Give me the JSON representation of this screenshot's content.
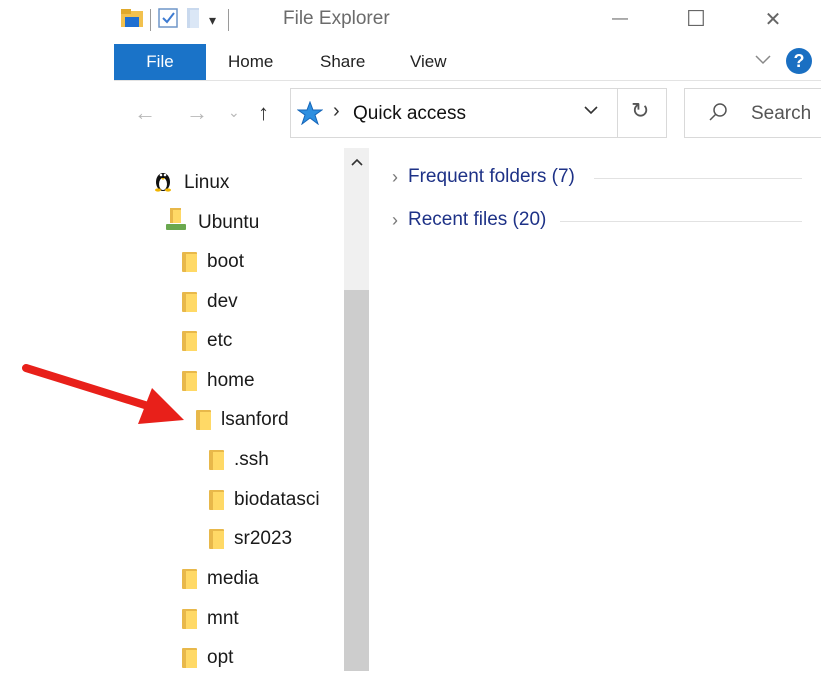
{
  "window": {
    "title": "File Explorer",
    "minimize_glyph": "—",
    "maximize_glyph": "☐",
    "close_glyph": "✕"
  },
  "ribbon": {
    "tabs": [
      "File",
      "Home",
      "Share",
      "View"
    ],
    "active_tab": "File",
    "help_label": "?"
  },
  "address_bar": {
    "location": "Quick access",
    "location_icon": "quick-access-star-icon"
  },
  "search": {
    "placeholder": "Search"
  },
  "navigation_pane": {
    "items": [
      {
        "label": "Linux",
        "icon": "linux-penguin-icon",
        "level": 0
      },
      {
        "label": "Ubuntu",
        "icon": "drive-icon",
        "level": 1
      },
      {
        "label": "boot",
        "icon": "folder-icon",
        "level": 2
      },
      {
        "label": "dev",
        "icon": "folder-icon",
        "level": 2
      },
      {
        "label": "etc",
        "icon": "folder-icon",
        "level": 2
      },
      {
        "label": "home",
        "icon": "folder-icon",
        "level": 2
      },
      {
        "label": "lsanford",
        "icon": "folder-icon",
        "level": 3
      },
      {
        "label": ".ssh",
        "icon": "folder-icon",
        "level": 4
      },
      {
        "label": "biodatasci",
        "icon": "folder-icon",
        "level": 4
      },
      {
        "label": "sr2023",
        "icon": "folder-icon",
        "level": 4
      },
      {
        "label": "media",
        "icon": "folder-icon",
        "level": 2
      },
      {
        "label": "mnt",
        "icon": "folder-icon",
        "level": 2
      },
      {
        "label": "opt",
        "icon": "folder-icon",
        "level": 2
      }
    ]
  },
  "content": {
    "groups": [
      {
        "label": "Frequent folders (7)"
      },
      {
        "label": "Recent files (20)"
      }
    ]
  },
  "annotation": {
    "arrow_color": "#e8201a",
    "target": "lsanford"
  },
  "colors": {
    "file_tab": "#1a73c8",
    "group_header": "#1e3287",
    "folder": "#ffd966"
  }
}
